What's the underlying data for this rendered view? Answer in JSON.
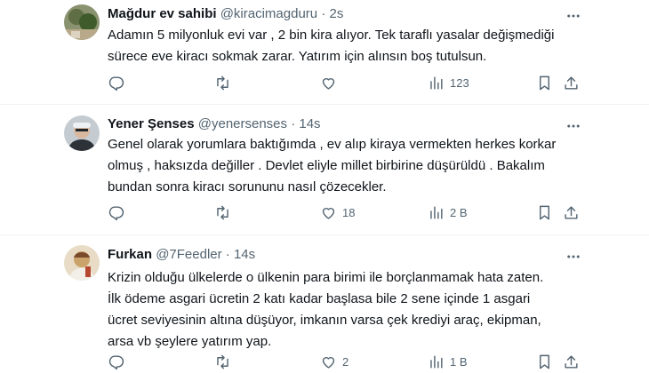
{
  "tweets": [
    {
      "name": "Mağdur ev sahibi",
      "handle": "@kiracimagduru",
      "separator": "·",
      "time": "2s",
      "text": "Adamın 5 milyonluk evi var , 2 bin kira alıyor. Tek taraflı yasalar değişmediği\nsürece eve kiracı sokmak zarar. Yatırım için alınsın boş tutulsun.",
      "replies": "",
      "retweets": "",
      "likes": "",
      "views": "123",
      "avatar_colors": [
        "#6b7b55",
        "#3f5a2b"
      ]
    },
    {
      "name": "Yener Şenses",
      "handle": "@yenersenses",
      "separator": "·",
      "time": "14s",
      "text": "Genel olarak yorumlara baktığımda , ev alıp kiraya vermekten herkes korkar\nolmuş , haksızda değiller . Devlet eliyle millet birbirine düşürüldü . Bakalım\nbundan sonra kiracı sorununu nasıl çözecekler.",
      "replies": "",
      "retweets": "",
      "likes": "18",
      "views": "2 B",
      "avatar_colors": [
        "#9aa3a8",
        "#2c3238"
      ]
    },
    {
      "name": "Furkan",
      "handle": "@7Feedler",
      "separator": "·",
      "time": "14s",
      "text": "Krizin olduğu ülkelerde o ülkenin para birimi ile borçlanmamak hata zaten.\nİlk ödeme asgari ücretin 2 katı kadar başlasa bile 2 sene içinde 1 asgari\nücret seviyesinin altına düşüyor, imkanın varsa çek krediyi araç, ekipman,\narsa vb şeylere yatırım yap.",
      "replies": "",
      "retweets": "",
      "likes": "2",
      "views": "1 B",
      "avatar_colors": [
        "#c9a36a",
        "#7a4a2a"
      ]
    }
  ],
  "icons": {
    "reply": "reply-icon",
    "retweet": "retweet-icon",
    "like": "heart-icon",
    "views": "views-icon",
    "bookmark": "bookmark-icon",
    "share": "share-icon",
    "more": "more-icon"
  },
  "colors": {
    "text": "#0f1419",
    "secondary": "#536471",
    "divider": "#eff3f4"
  }
}
